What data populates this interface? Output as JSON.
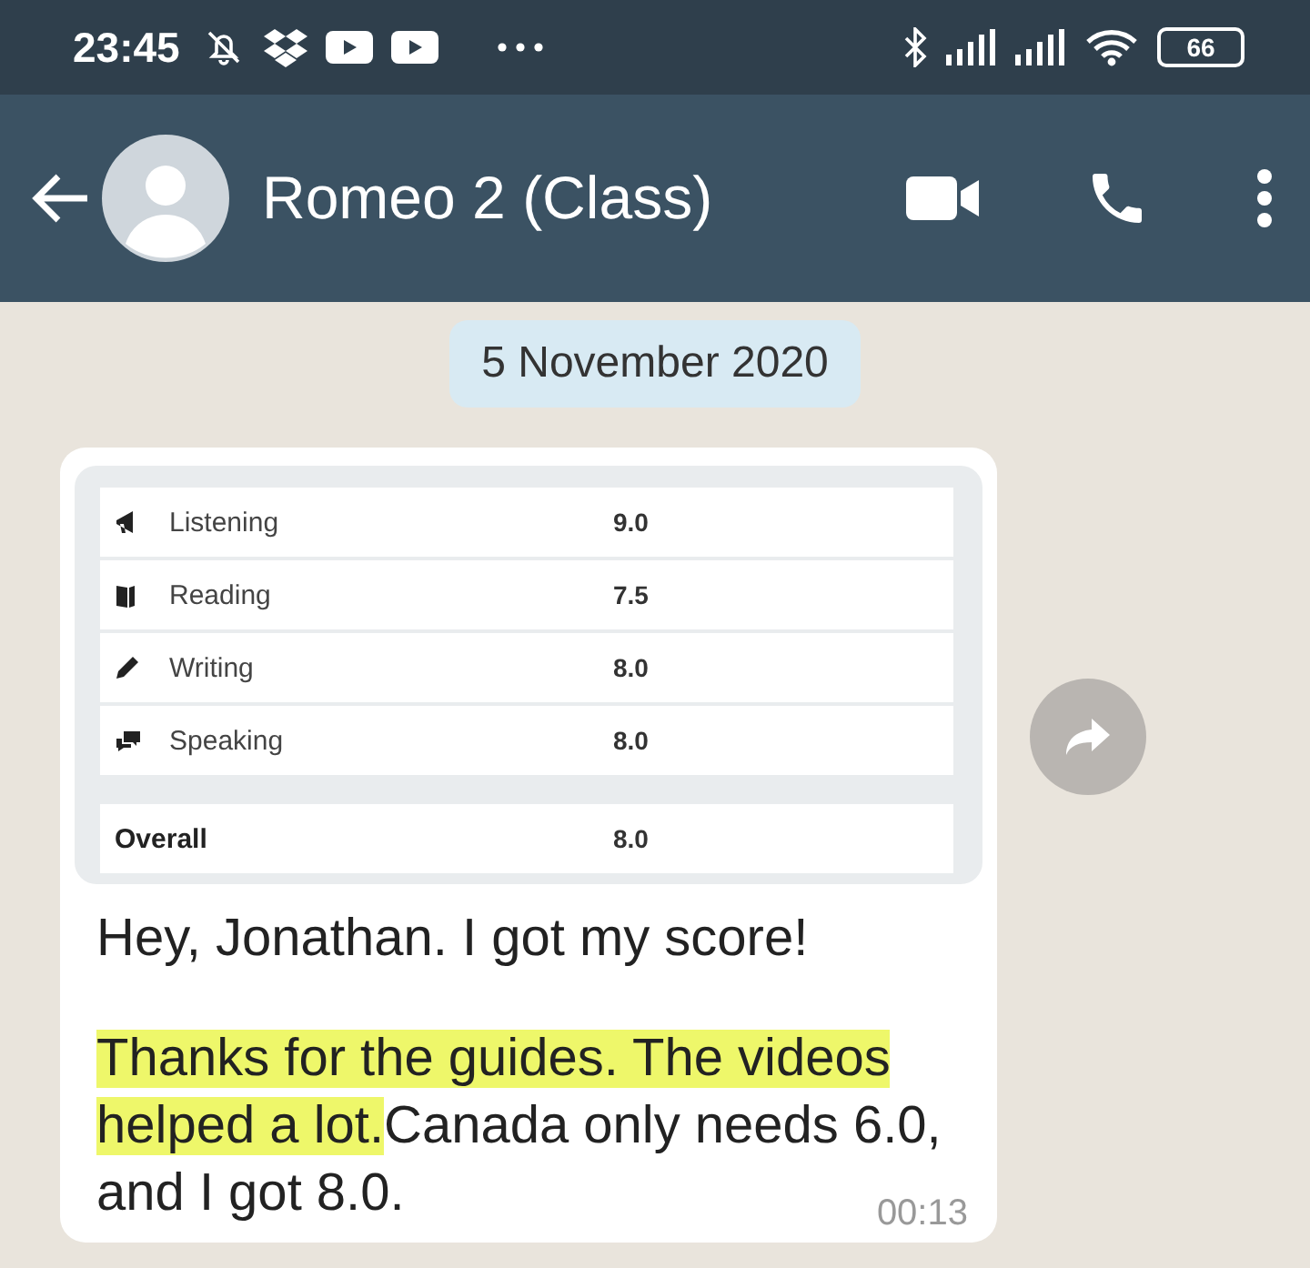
{
  "status_bar": {
    "time": "23:45",
    "battery": "66"
  },
  "header": {
    "contact_name": "Romeo 2 (Class)"
  },
  "date_chip": "5 November 2020",
  "message": {
    "score_table": {
      "rows": [
        {
          "kind": "listening",
          "label": "Listening",
          "value": "9.0"
        },
        {
          "kind": "reading",
          "label": "Reading",
          "value": "7.5"
        },
        {
          "kind": "writing",
          "label": "Writing",
          "value": "8.0"
        },
        {
          "kind": "speaking",
          "label": "Speaking",
          "value": "8.0"
        }
      ],
      "overall": {
        "label": "Overall",
        "value": "8.0"
      }
    },
    "paragraphs": [
      {
        "text": "Hey, Jonathan. I got my score!"
      },
      {
        "highlighted": "Thanks for the guides. The videos helped a lot.",
        "text": "Canada only needs 6.0, and I got 8.0."
      }
    ],
    "time": "00:13"
  }
}
